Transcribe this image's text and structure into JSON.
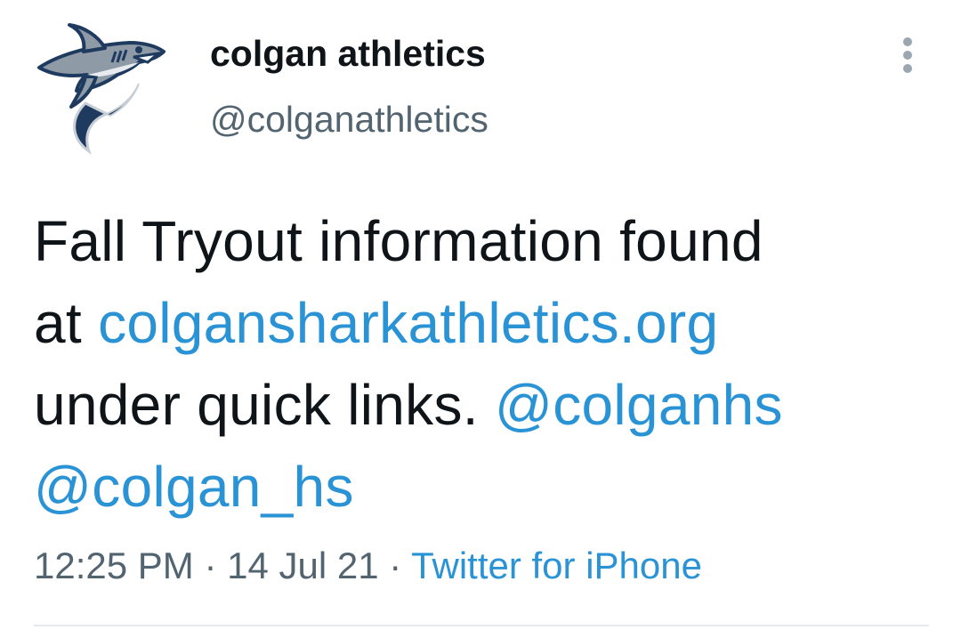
{
  "account": {
    "display_name": "colgan athletics",
    "handle": "@colganathletics",
    "avatar_icon": "shark-logo-icon"
  },
  "menu": {
    "icon": "more-vertical-icon"
  },
  "tweet": {
    "line1": "Fall Tryout information found",
    "line2_prefix": "at ",
    "link_url_text": "colgansharkathletics.org",
    "line3_prefix": "under quick links. ",
    "mention_1": "@colganhs",
    "mention_2": "@colgan_hs"
  },
  "meta": {
    "time": "12:25 PM",
    "separator_1": " · ",
    "date": "14 Jul 21",
    "separator_2": " · ",
    "source": "Twitter for iPhone"
  },
  "colors": {
    "text": "#0f1419",
    "secondary": "#536471",
    "link": "#2a93d5",
    "divider": "#e6e9ec"
  }
}
